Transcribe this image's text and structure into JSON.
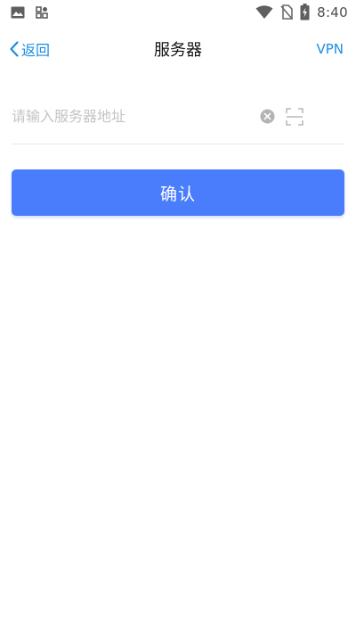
{
  "status_bar": {
    "time": "8:40",
    "left_icons": [
      "image-icon",
      "app-grid-icon"
    ],
    "right_icons": [
      "wifi-icon",
      "no-sim-icon",
      "battery-charging-icon"
    ]
  },
  "nav": {
    "back_label": "返回",
    "title": "服务器",
    "right_label": "VPN"
  },
  "server_input": {
    "value": "",
    "placeholder": "请输入服务器地址"
  },
  "actions": {
    "clear_icon": "clear-icon",
    "scan_icon": "scan-icon",
    "confirm_label": "确认"
  },
  "colors": {
    "accent": "#1a8fe3",
    "button": "#4a7dfc",
    "placeholder": "#c4c4c4"
  }
}
